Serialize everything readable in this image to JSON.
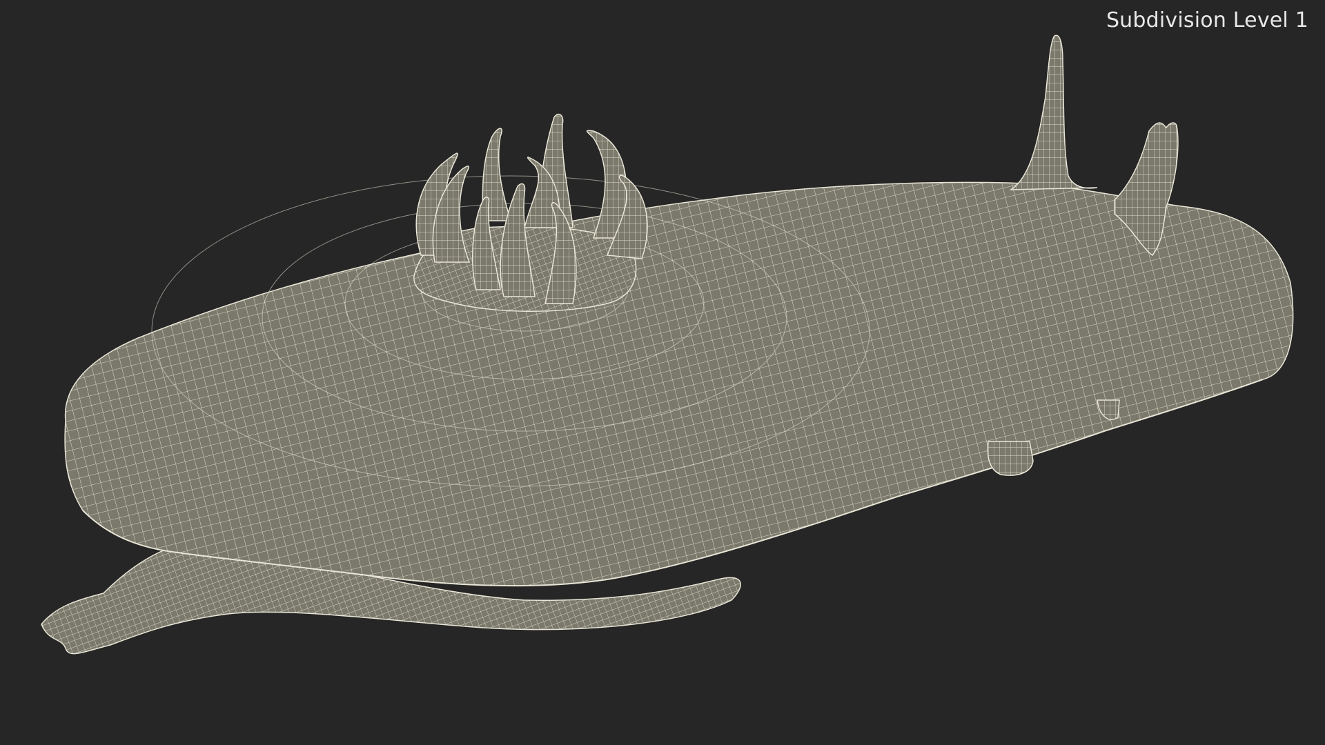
{
  "viewport": {
    "label": "Subdivision Level 1",
    "background_color": "#262626"
  },
  "model": {
    "fill_color": "#7a796b",
    "wire_color": "#e9e6d7",
    "shadow_color": "#5f5e53"
  }
}
